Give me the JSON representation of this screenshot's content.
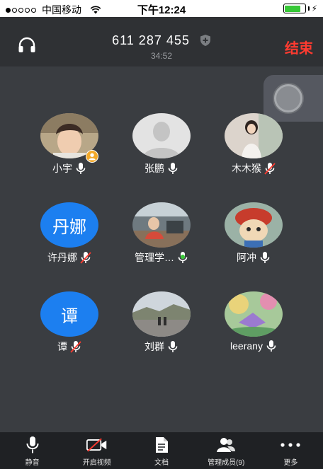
{
  "status_bar": {
    "carrier": "中国移动",
    "time": "下午12:24",
    "battery_level": 0.82
  },
  "call": {
    "number": "611 287 455",
    "duration": "34:52",
    "end_label": "结束"
  },
  "participants": [
    {
      "name": "小宇",
      "avatar_type": "photo",
      "mic": "on",
      "host": true
    },
    {
      "name": "张鹏",
      "avatar_type": "default",
      "mic": "on"
    },
    {
      "name": "木木猴",
      "avatar_type": "photo",
      "mic": "muted"
    },
    {
      "name": "许丹娜",
      "avatar_type": "text",
      "avatar_text": "丹娜",
      "mic": "muted"
    },
    {
      "name": "管理学…",
      "avatar_type": "photo",
      "mic": "speaking"
    },
    {
      "name": "阿冲",
      "avatar_type": "photo",
      "mic": "on"
    },
    {
      "name": "谭",
      "avatar_type": "text",
      "avatar_text": "谭",
      "mic": "muted"
    },
    {
      "name": "刘群",
      "avatar_type": "photo",
      "mic": "on"
    },
    {
      "name": "leerany",
      "avatar_type": "photo",
      "mic": "on"
    }
  ],
  "bottom_bar": {
    "mute": "静音",
    "video": "开启视频",
    "docs": "文档",
    "members": "管理成员(9)",
    "more": "更多"
  },
  "colors": {
    "accent_blue": "#1c7ff0",
    "end_red": "#ff3b30",
    "speaking_green": "#37c837"
  }
}
